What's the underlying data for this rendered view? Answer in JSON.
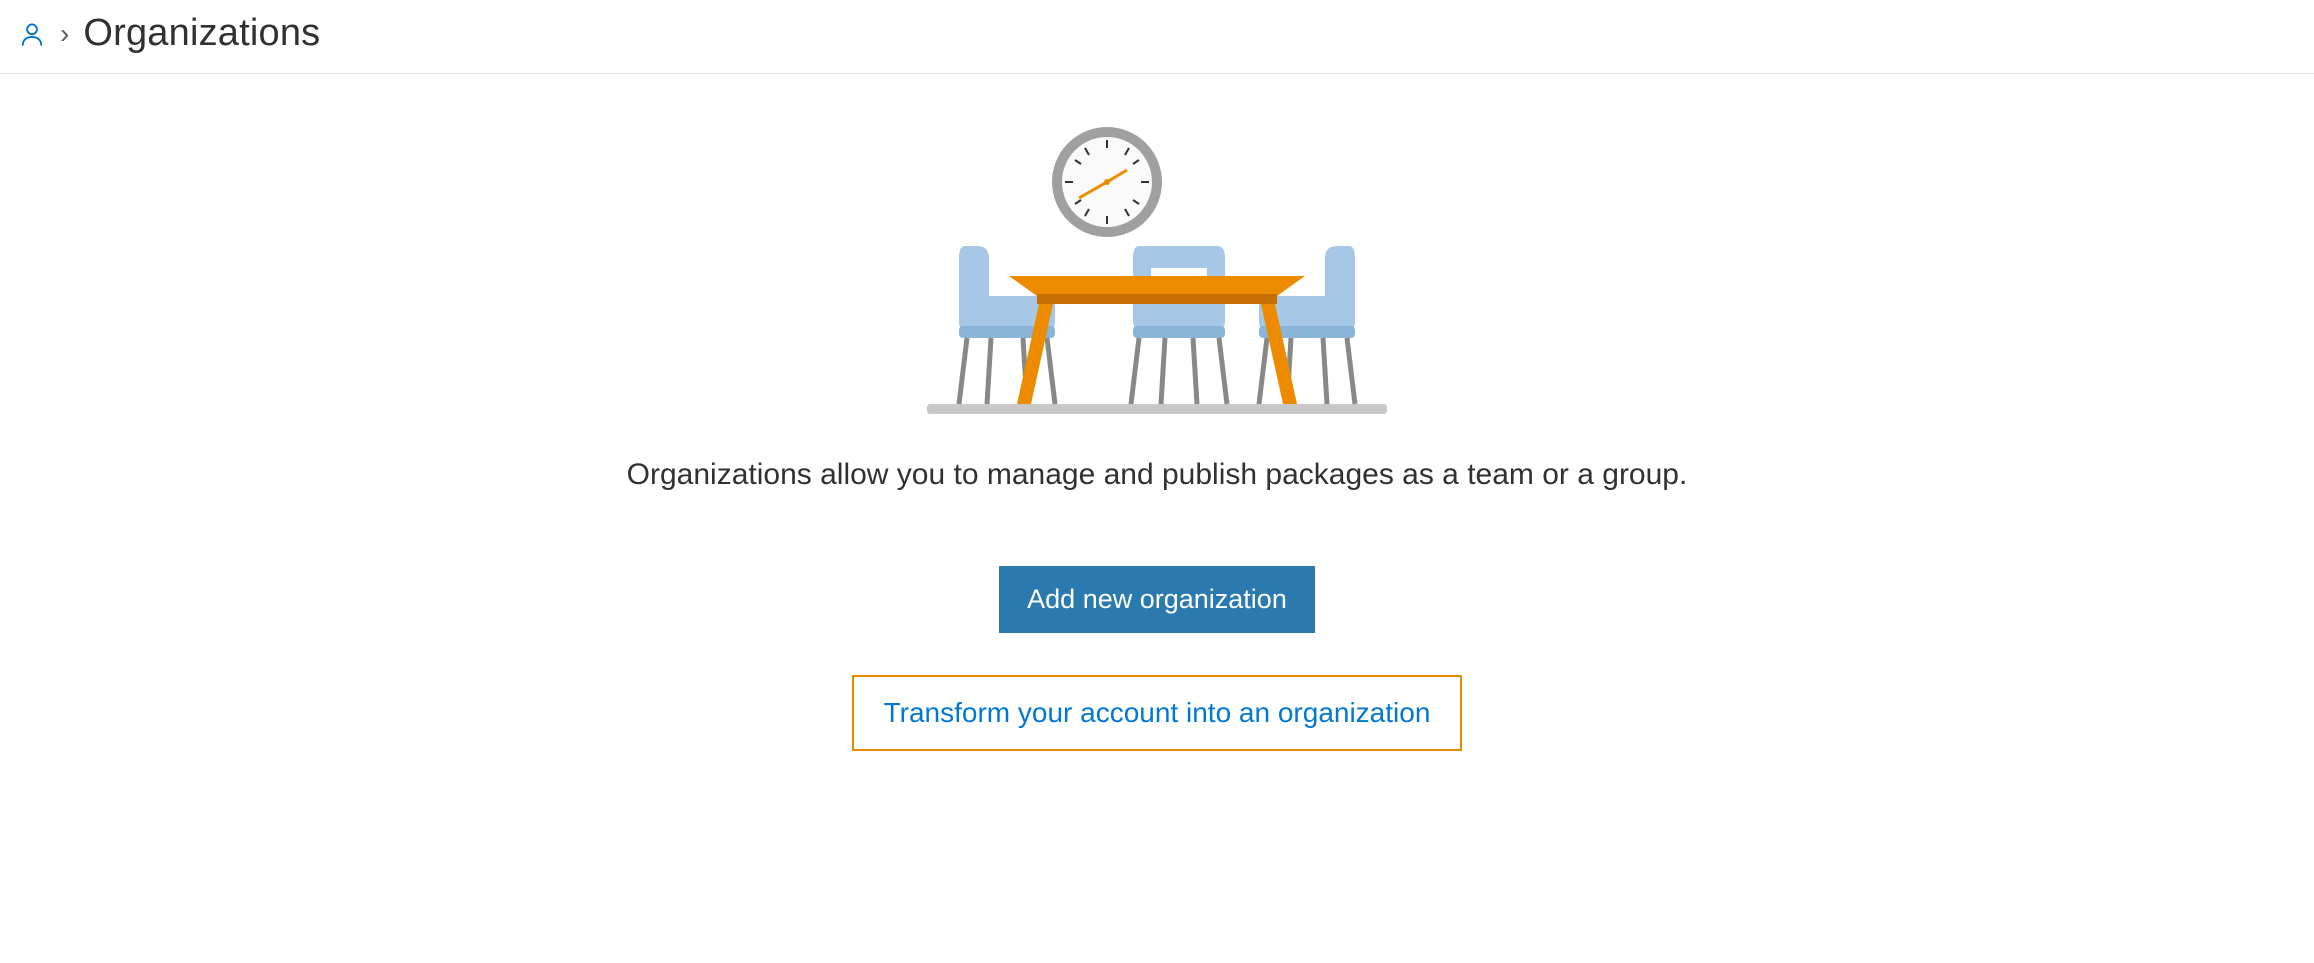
{
  "breadcrumb": {
    "title": "Organizations"
  },
  "main": {
    "description": "Organizations allow you to manage and publish packages as a team or a group.",
    "primary_button": "Add new organization",
    "secondary_button": "Transform your account into an organization"
  },
  "colors": {
    "accent_blue": "#0078d4",
    "button_blue": "#2a7ab0",
    "outline_orange": "#e68a00",
    "chair_blue": "#a6c8e6",
    "table_orange": "#ed8b00"
  },
  "illustration": {
    "name": "meeting-room",
    "elements": [
      "clock",
      "table",
      "chairs"
    ]
  }
}
